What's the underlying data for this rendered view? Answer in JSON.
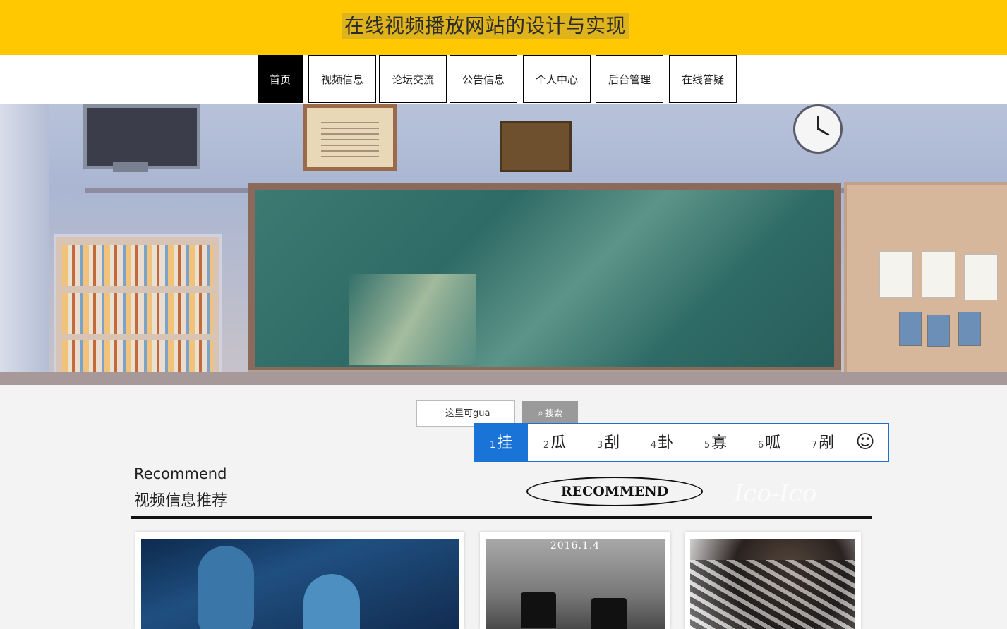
{
  "header": {
    "title": "在线视频播放网站的设计与实现"
  },
  "nav": {
    "items": [
      {
        "label": "首页",
        "active": true
      },
      {
        "label": "视频信息"
      },
      {
        "label": "论坛交流"
      },
      {
        "label": "公告信息"
      },
      {
        "label": "个人中心"
      },
      {
        "label": "后台管理"
      },
      {
        "label": "在线答疑"
      }
    ]
  },
  "search": {
    "input_value": "这里可gua",
    "button_label": "搜索",
    "button_icon": "search-icon"
  },
  "ime": {
    "candidates": [
      {
        "num": "1",
        "char": "挂",
        "selected": true
      },
      {
        "num": "2",
        "char": "瓜"
      },
      {
        "num": "3",
        "char": "刮"
      },
      {
        "num": "4",
        "char": "卦"
      },
      {
        "num": "5",
        "char": "寡"
      },
      {
        "num": "6",
        "char": "呱"
      },
      {
        "num": "7",
        "char": "剐"
      }
    ],
    "extra_icon": "smiley-icon"
  },
  "recommend": {
    "title_en": "Recommend",
    "title_cn": "视频信息推荐",
    "badge": "RECOMMEND",
    "cards": [
      {
        "poster_text": ""
      },
      {
        "poster_text": "2016.1.4"
      },
      {
        "poster_text": ""
      }
    ]
  },
  "colors": {
    "header_bg": "#ffc800",
    "nav_active_bg": "#000000",
    "ime_selected": "#1a74d8"
  }
}
